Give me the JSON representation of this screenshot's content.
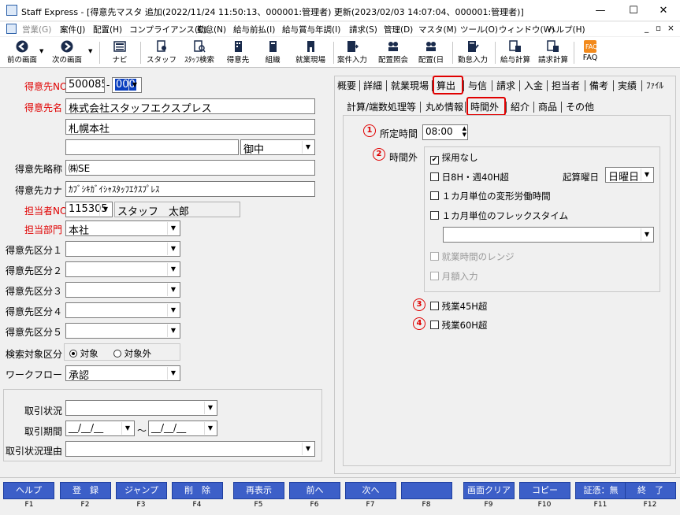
{
  "window": {
    "title": "Staff Express - [得意先マスタ 追加(2022/11/24 11:50:13、000001:管理者) 更新(2023/02/03 14:07:04、000001:管理者)]",
    "minimize": "—",
    "maximize": "☐",
    "close": "✕"
  },
  "menu": [
    "営業(G)",
    "案件(J)",
    "配置(H)",
    "コンプライアンス(C)",
    "勤怠(N)",
    "給与前払(I)",
    "給与賞与年調(I)",
    "請求(S)",
    "管理(D)",
    "マスタ(M)",
    "ツール(O)",
    "ウィンドウ(W)",
    "ヘルプ(H)"
  ],
  "mdi": {
    "min": "_",
    "restore": "▫",
    "close": "×"
  },
  "toolbar": {
    "back": "前の画面",
    "next": "次の画面",
    "navi": "ナビ",
    "staff": "スタッフ",
    "staff_search": "ｽﾀｯﾌ検索",
    "customer": "得意先",
    "org": "組織",
    "site": "就業現場",
    "case_input": "案件入力",
    "assign_ref": "配置照会",
    "assign_day": "配置(日",
    "attend_input": "勤怠入力",
    "pay_calc": "給与計算",
    "bill_calc": "請求計算",
    "faq": "FAQ"
  },
  "form": {
    "cust_no_label": "得意先NO",
    "cust_no": "500085",
    "cust_no_dash": "-",
    "cust_no_sub": "000",
    "cust_name_label": "得意先名",
    "cust_name": "株式会社スタッフエクスプレス",
    "cust_name2": "札幌本社",
    "cust_name3": "",
    "honorific": "御中",
    "short_label": "得意先略称",
    "short": "㈱SE",
    "kana_label": "得意先カナ",
    "kana": "ｶﾌﾞｼｷｶﾞｲｼｬｽﾀｯﾌｴｸｽﾌﾟﾚｽ",
    "rep_label": "担当者NO",
    "rep_no": "115305",
    "rep_name": "スタッフ　太郎",
    "dept_label": "担当部門",
    "dept": "本社",
    "cat1": "得意先区分１",
    "cat2": "得意先区分２",
    "cat3": "得意先区分３",
    "cat4": "得意先区分４",
    "cat5": "得意先区分５",
    "search_label": "検索対象区分",
    "search_on": "対象",
    "search_off": "対象外",
    "workflow_label": "ワークフロー",
    "workflow": "承認",
    "trade_status": "取引状況",
    "trade_period": "取引期間",
    "period_from": "__/__/__",
    "period_tilde": "～",
    "period_to": "__/__/__",
    "trade_reason": "取引状況理由"
  },
  "tabs1": [
    "概要",
    "詳細",
    "就業現場",
    "算出",
    "与信",
    "請求",
    "入金",
    "担当者",
    "備考",
    "実績",
    "ﾌｧｲﾙ"
  ],
  "tabs2": [
    "計算/端数処理等",
    "丸め情報",
    "時間外",
    "紹介",
    "商品",
    "その他"
  ],
  "overtime": {
    "n1": "1",
    "prescribed_label": "所定時間",
    "prescribed": "08:00",
    "n2": "2",
    "overtime_label": "時間外",
    "opt_none": "採用なし",
    "opt_8h40h": "日8H・週40H超",
    "start_day_label": "起算曜日",
    "start_day": "日曜日",
    "opt_monthly_var": "１カ月単位の変形労働時間",
    "opt_monthly_flex": "１カ月単位のフレックスタイム",
    "opt_range": "就業時間のレンジ",
    "opt_amount": "月額入力",
    "n3": "3",
    "over45": "残業45H超",
    "n4": "4",
    "over60": "残業60H超"
  },
  "fkeys": [
    {
      "label": "ヘルプ",
      "key": "F1"
    },
    {
      "label": "登　録",
      "key": "F2"
    },
    {
      "label": "ジャンプ",
      "key": "F3"
    },
    {
      "label": "削　除",
      "key": "F4"
    },
    {
      "label": "再表示",
      "key": "F5"
    },
    {
      "label": "前へ",
      "key": "F6"
    },
    {
      "label": "次へ",
      "key": "F7"
    },
    {
      "label": "",
      "key": "F8"
    },
    {
      "label": "画面クリア",
      "key": "F9"
    },
    {
      "label": "コピー",
      "key": "F10"
    },
    {
      "label": "証憑：無",
      "key": "F11"
    },
    {
      "label": "終　了",
      "key": "F12"
    }
  ]
}
